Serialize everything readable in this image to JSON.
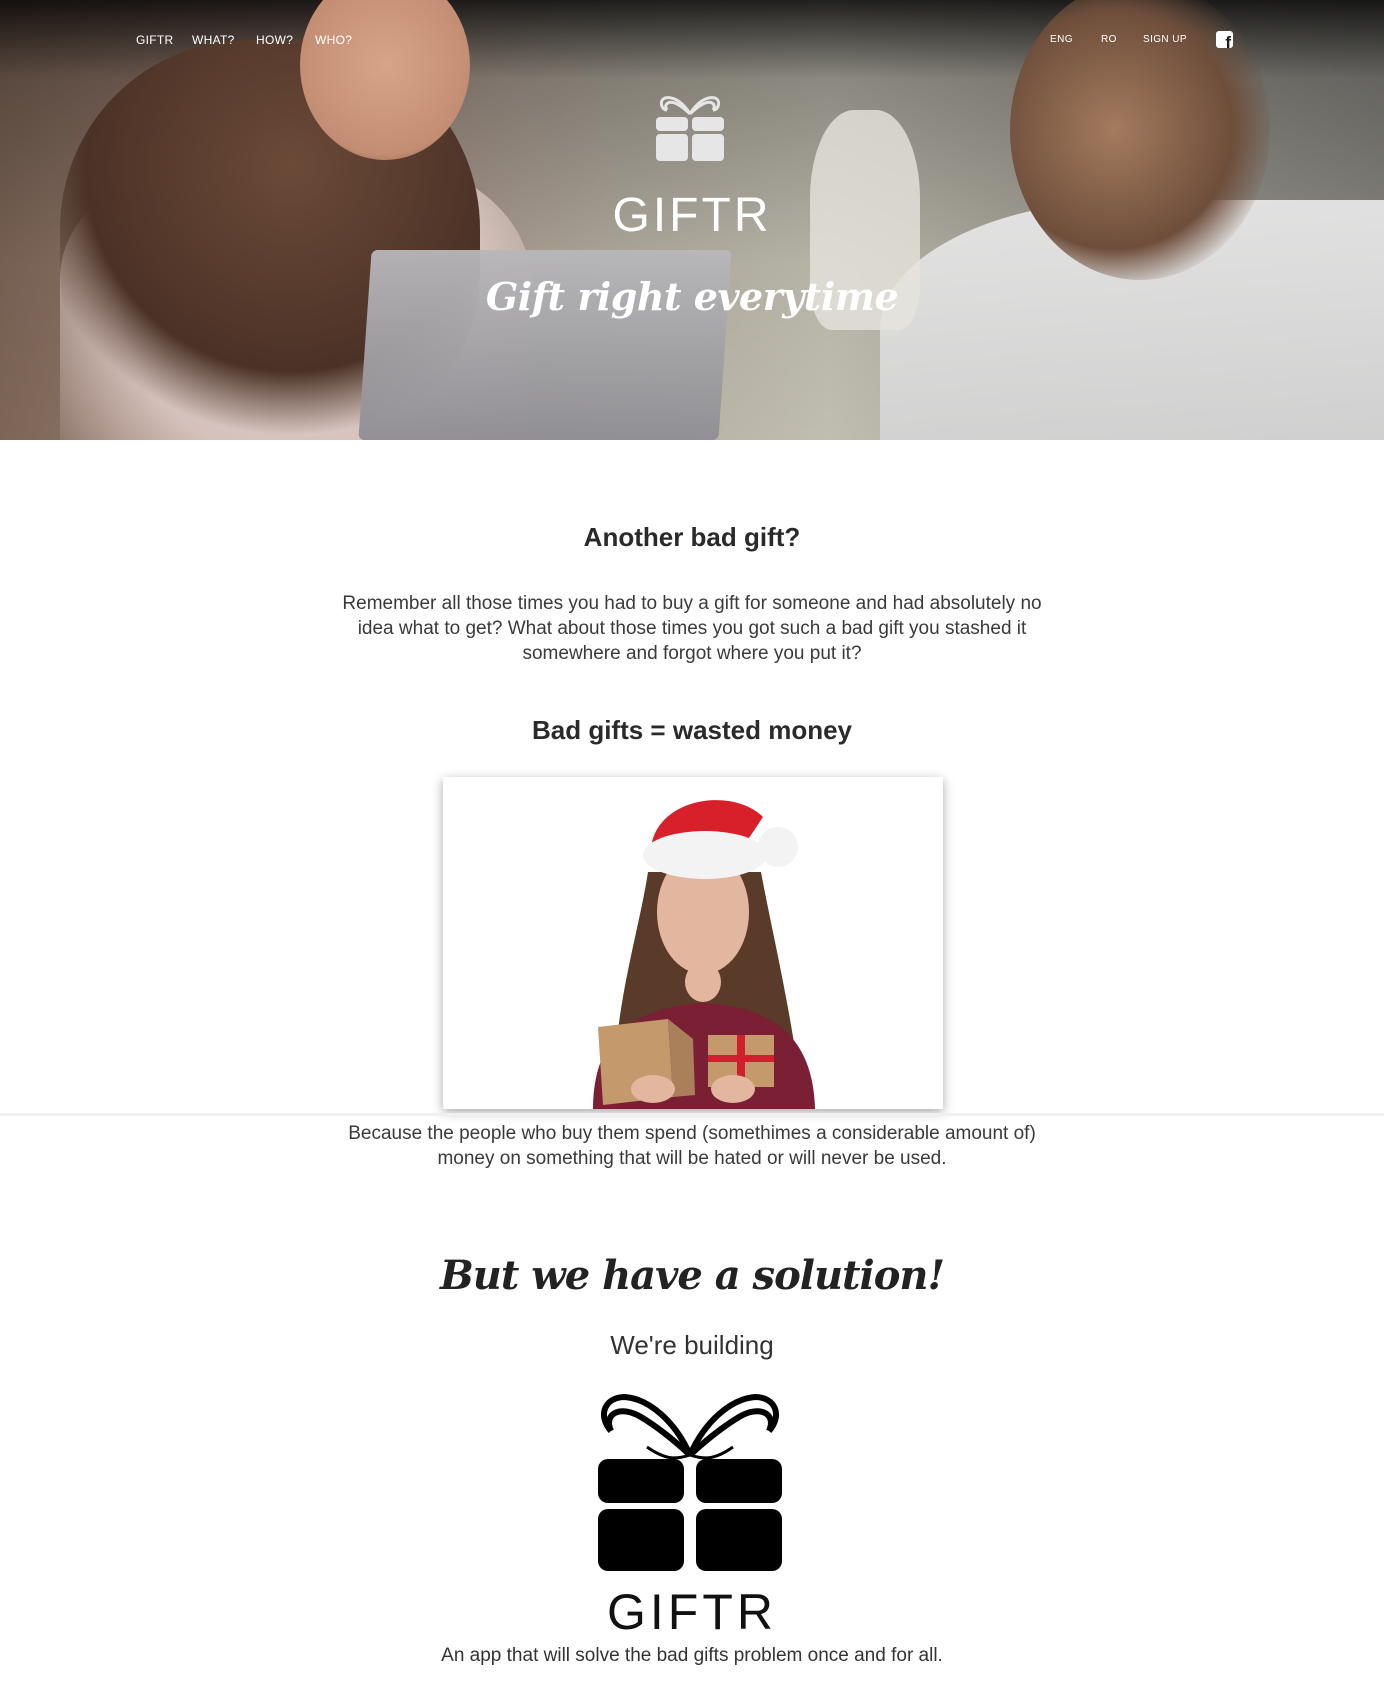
{
  "nav": {
    "left": [
      "GIFTR",
      "WHAT?",
      "HOW?",
      "WHO?"
    ],
    "right": [
      "ENG",
      "RO",
      "SIGN UP"
    ],
    "social_icon": "facebook-icon"
  },
  "hero": {
    "title": "GIFTR",
    "tagline": "Gift right everytime",
    "logo_icon": "gift-icon"
  },
  "section_bad_gift": {
    "title": "Another bad gift?",
    "text": "Remember all those times you had to buy a gift for someone and had absolutely no idea what to get? What about those times you got such a bad gift you stashed it somewhere and forgot where you put it?"
  },
  "section_wasted": {
    "title": "Bad gifts = wasted money",
    "text": "Because the people who buy them spend (somethimes a considerable amount of) money on something that will be hated or will never be used."
  },
  "section_solution": {
    "title": "But we have a solution!",
    "subtitle": "We're building",
    "brand": "GIFTR",
    "text": "An app that will solve the bad gifts problem once and for all."
  },
  "colors": {
    "text": "#333333",
    "heading": "#2a2a2a",
    "hero_text": "#ffffff"
  }
}
